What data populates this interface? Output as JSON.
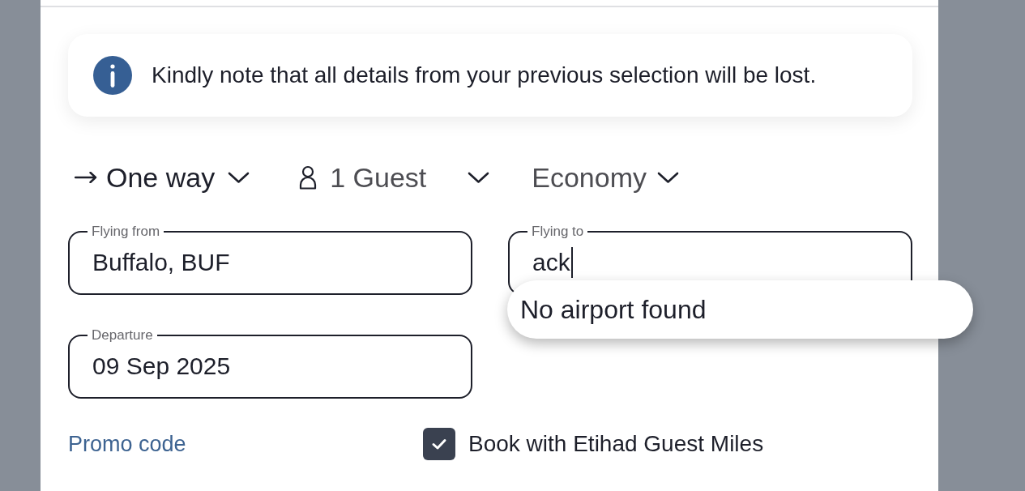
{
  "notice": {
    "text": "Kindly note that all details from your previous selection will be lost."
  },
  "trip_options": [
    {
      "kind": "trip_type",
      "label": "One way"
    },
    {
      "kind": "guests",
      "label": "1 Guest"
    },
    {
      "kind": "cabin",
      "label": "Economy"
    }
  ],
  "fields": [
    {
      "label": "Flying from",
      "value": "Buffalo, BUF",
      "focused": false
    },
    {
      "label": "Flying to",
      "value": "ack",
      "focused": true
    },
    {
      "label": "Departure",
      "value": "09 Sep 2025",
      "focused": false
    }
  ],
  "suggestions": {
    "message": "No airport found"
  },
  "promo_link": "Promo code",
  "miles_option": {
    "label": "Book with Etihad Guest Miles",
    "checked": true
  }
}
